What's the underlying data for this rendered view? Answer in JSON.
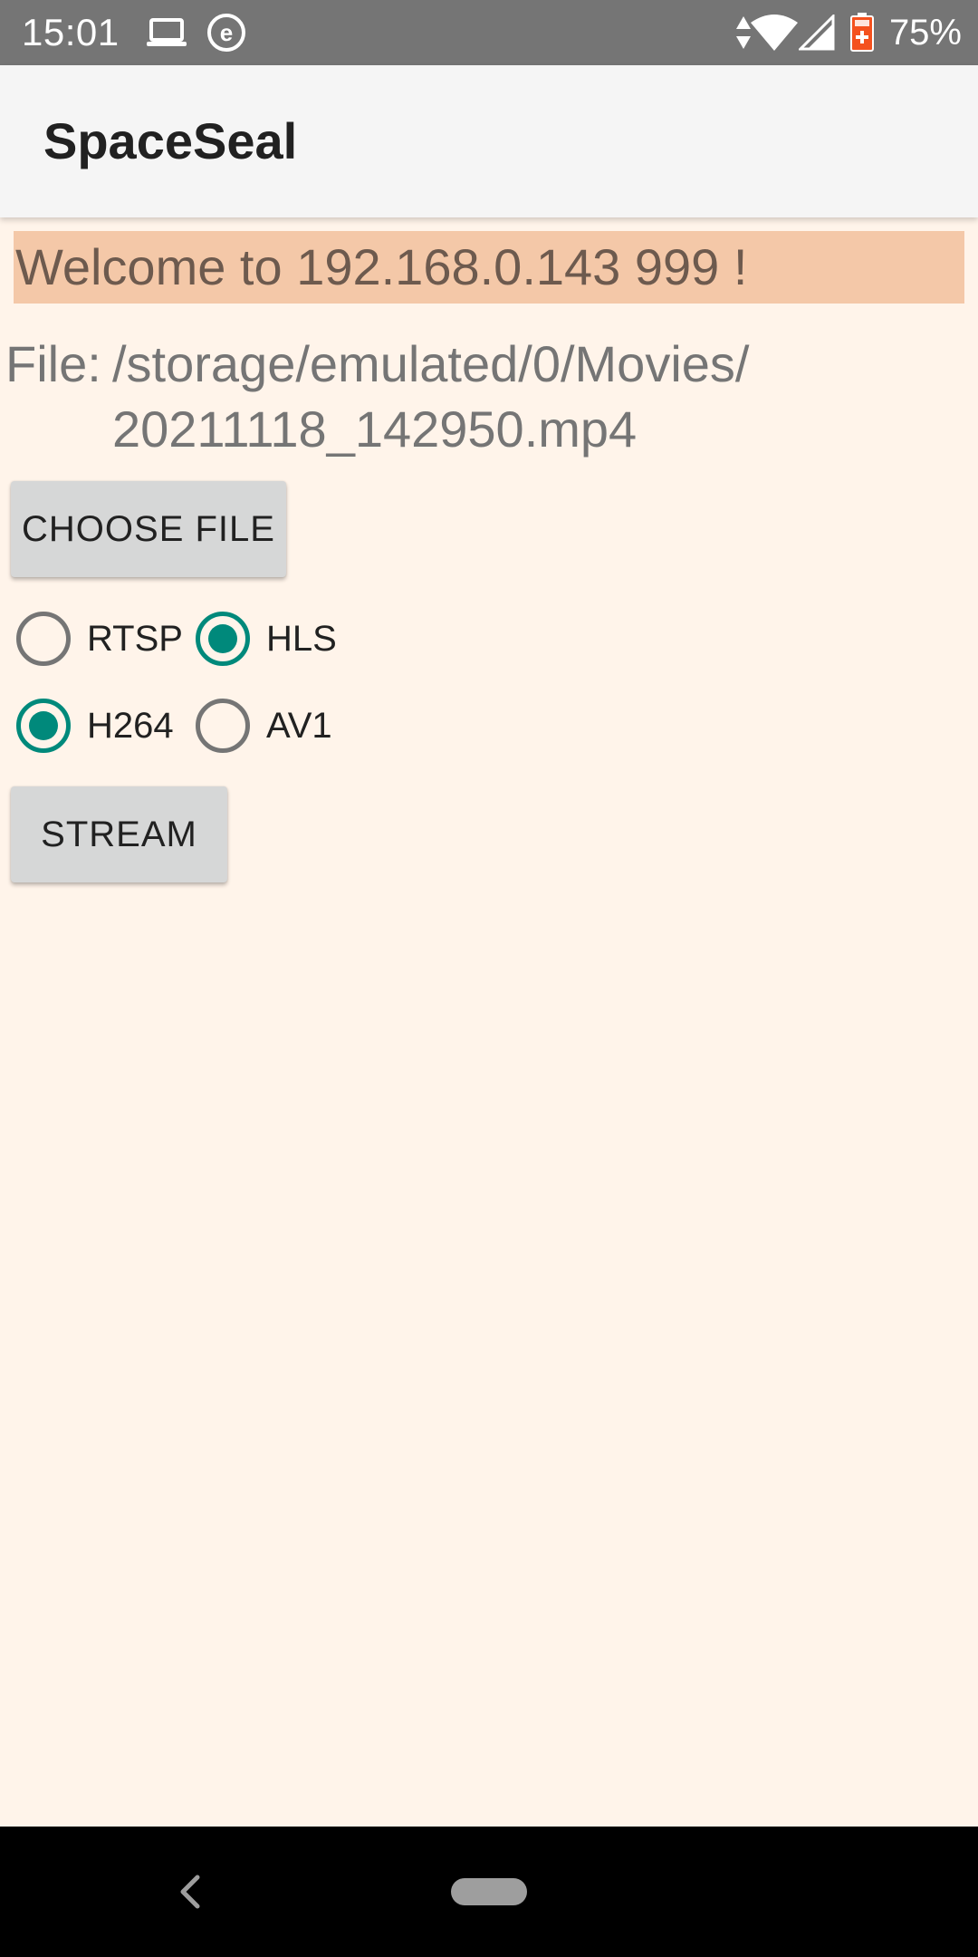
{
  "status_bar": {
    "time": "15:01",
    "icons": [
      "laptop-icon",
      "e-circle-icon",
      "data-arrows-icon",
      "wifi-icon",
      "signal-icon",
      "battery-icon"
    ],
    "battery_percent_text": "75%",
    "battery_level": 0.75
  },
  "app_bar": {
    "title": "SpaceSeal"
  },
  "welcome": {
    "text": "Welcome to 192.168.0.143 999 !"
  },
  "file": {
    "label": "File:",
    "path_line1": "/storage/emulated/0/Movies/",
    "path_line2": "20211118_142950.mp4"
  },
  "buttons": {
    "choose_file": "CHOOSE FILE",
    "stream": "STREAM"
  },
  "protocol_group": {
    "options": [
      {
        "label": "RTSP",
        "checked": false
      },
      {
        "label": "HLS",
        "checked": true
      }
    ]
  },
  "codec_group": {
    "options": [
      {
        "label": "H264",
        "checked": true
      },
      {
        "label": "AV1",
        "checked": false
      }
    ]
  },
  "colors": {
    "background": "#fff4ea",
    "banner": "#f4c8a8",
    "accent": "#00897b",
    "status_bar": "#757575",
    "app_bar": "#f5f5f5",
    "battery_warning": "#f4511e"
  }
}
